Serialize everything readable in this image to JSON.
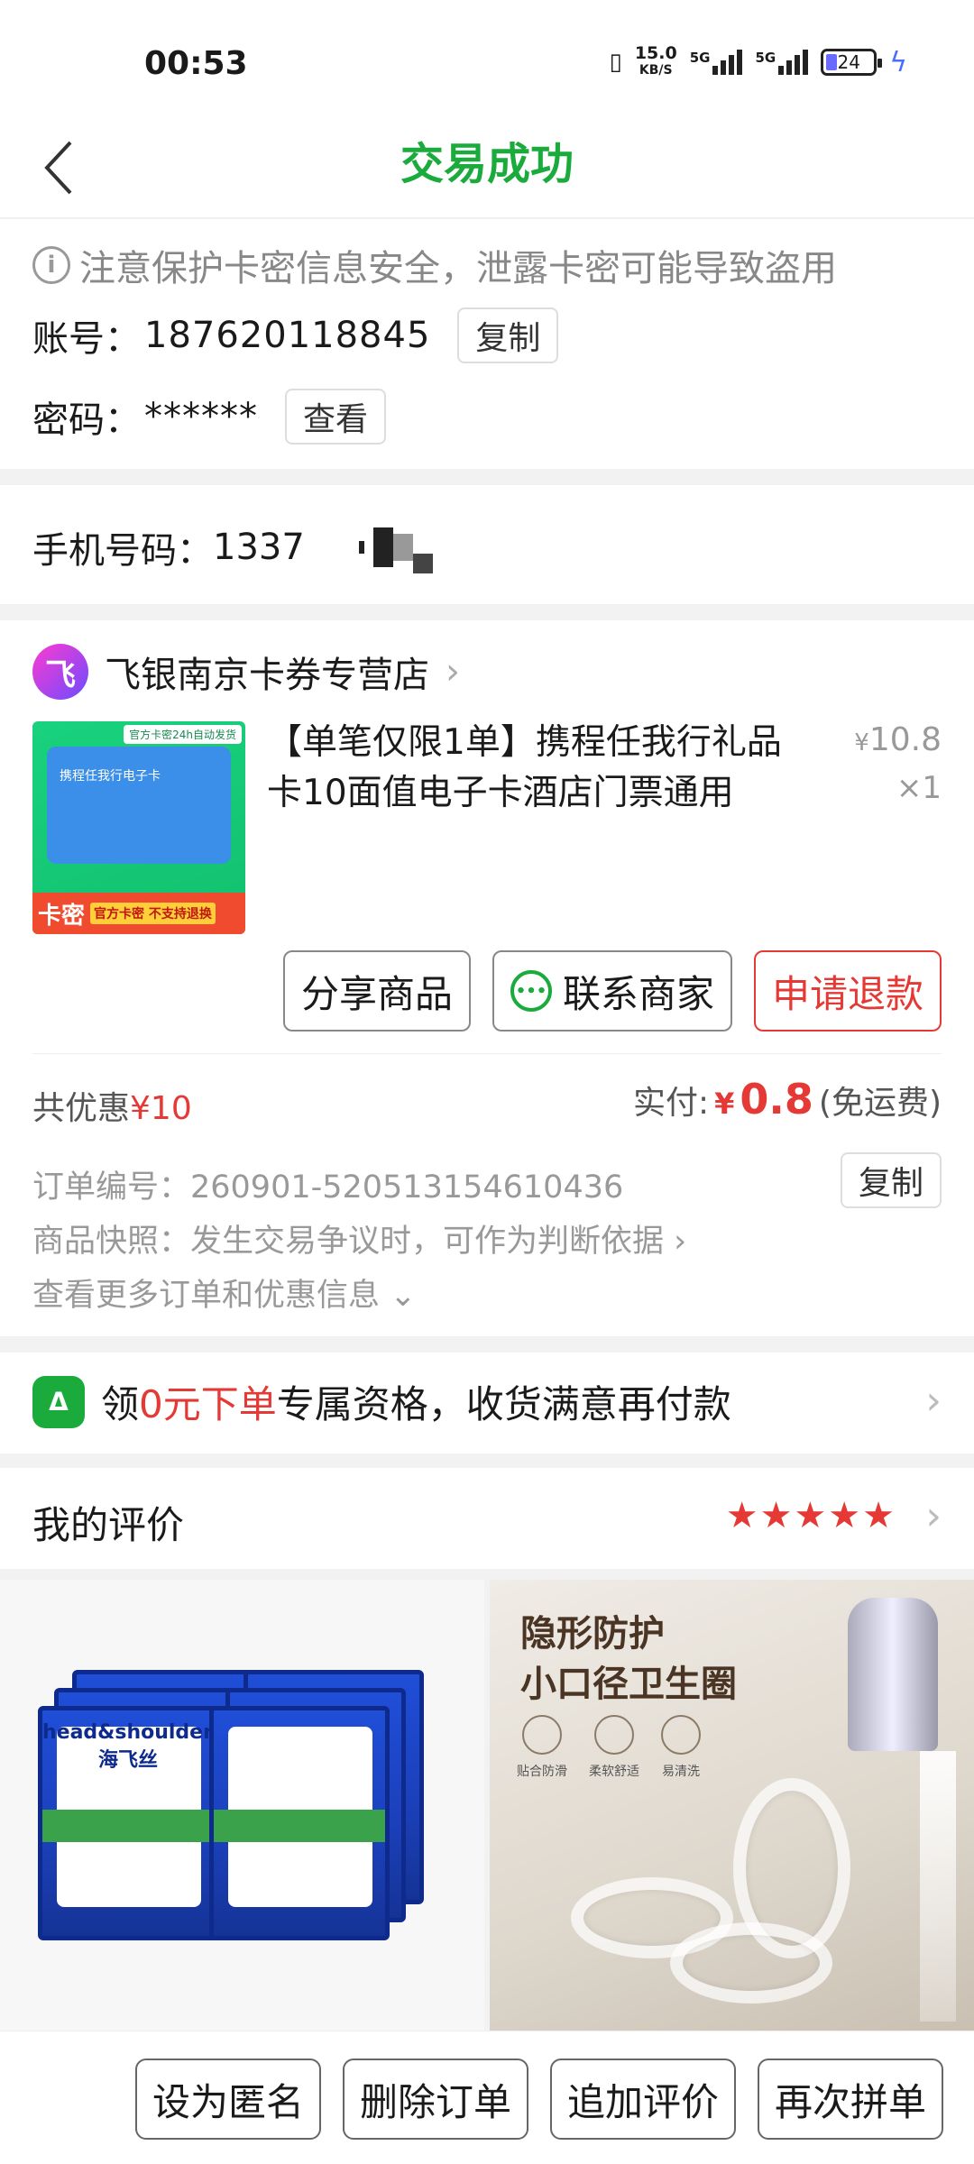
{
  "status_bar": {
    "time": "00:53",
    "speed_value": "15.0",
    "speed_unit": "KB/S",
    "net_a": "5G",
    "net_b": "5G",
    "battery": "24"
  },
  "header": {
    "title": "交易成功"
  },
  "card_secret": {
    "notice": "注意保护卡密信息安全，泄露卡密可能导致盗用",
    "account_label": "账号：",
    "account_value": "187620118845",
    "copy_label": "复制",
    "password_label": "密码：",
    "password_value": "******",
    "view_label": "查看"
  },
  "phone": {
    "label": "手机号码：",
    "value": "1337"
  },
  "order": {
    "store_logo": "飞",
    "store_name": "飞银南京卡券专营店",
    "product_title": "【单笔仅限1单】携程任我行礼品卡10面值电子卡酒店门票通用",
    "image_tag": "官方卡密24h自动发货",
    "image_card_text": "携程任我行电子卡",
    "image_bottom_main": "卡密",
    "image_bottom_sub": "官方卡密 不支持退换",
    "price_yen": "¥",
    "price_value": "10.8",
    "quantity": "×1",
    "actions": {
      "share": "分享商品",
      "contact": "联系商家",
      "refund": "申请退款"
    },
    "discount_label": "共优惠",
    "discount_value": "¥10",
    "paid_label": "实付:",
    "paid_yen": "¥",
    "paid_value": "0.8",
    "shipping": "(免运费)",
    "order_no": "订单编号：260901-520513154610436",
    "snapshot": "商品快照：发生交易争议时，可作为判断依据",
    "more": "查看更多订单和优惠信息",
    "copy_label": "复制"
  },
  "promo": {
    "pre": "领",
    "highlight": "0元下单",
    "post": "专属资格，收货满意再付款"
  },
  "review": {
    "title": "我的评价",
    "stars": "★★★★★"
  },
  "ads": {
    "left_brand": "head&shoulders 海飞丝",
    "right_headline_1": "隐形防护",
    "right_headline_2": "小口径卫生圈",
    "right_features": [
      "贴合防滑",
      "柔软舒适",
      "易清洗"
    ]
  },
  "bottom_bar": {
    "anonymous": "设为匿名",
    "delete": "删除订单",
    "append_review": "追加评价",
    "reorder": "再次拼单"
  },
  "colors": {
    "accent_green": "#1aab3c",
    "accent_red": "#e53935"
  }
}
